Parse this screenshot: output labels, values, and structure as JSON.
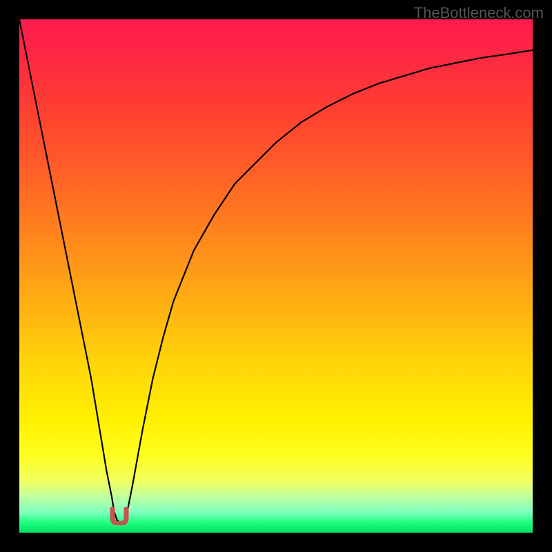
{
  "watermark": "TheBottleneck.com",
  "chart_data": {
    "type": "line",
    "title": "",
    "xlabel": "",
    "ylabel": "",
    "xlim": [
      0,
      100
    ],
    "ylim": [
      0,
      100
    ],
    "x": [
      0,
      2,
      4,
      6,
      8,
      10,
      12,
      14,
      16,
      17,
      18,
      18.5,
      19,
      19.5,
      20,
      20.5,
      21,
      22,
      24,
      26,
      28,
      30,
      34,
      38,
      42,
      46,
      50,
      55,
      60,
      65,
      70,
      75,
      80,
      85,
      90,
      95,
      100
    ],
    "values": [
      100,
      90,
      80,
      70,
      60,
      50,
      40,
      30,
      18,
      12,
      7,
      4,
      2.5,
      2,
      2,
      2.5,
      4,
      9,
      20,
      30,
      38,
      45,
      55,
      62,
      68,
      72,
      76,
      80,
      83,
      85.5,
      87.5,
      89,
      90.5,
      91.5,
      92.5,
      93.2,
      94
    ],
    "minimum_marker": {
      "x": 19.5,
      "y": 2
    }
  }
}
